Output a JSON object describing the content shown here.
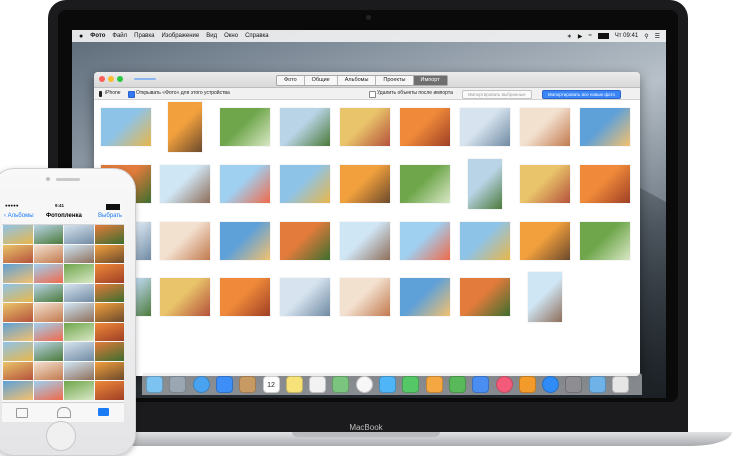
{
  "menubar": {
    "apple": "",
    "items": [
      "Фото",
      "Файл",
      "Правка",
      "Изображение",
      "Вид",
      "Окно",
      "Справка"
    ],
    "clock": "Чт 09:41",
    "status_icons": [
      "bluetooth-icon",
      "volume-icon",
      "wifi-icon",
      "battery-icon",
      "search-icon",
      "list-icon"
    ]
  },
  "photos_window": {
    "tabs": [
      "Фото",
      "Общие",
      "Альбомы",
      "Проекты",
      "Импорт"
    ],
    "active_tab": "Импорт",
    "device": "iPhone",
    "open_photos_label": "Открывать «Фото» для этого устройства",
    "delete_after_label": "Удалить объекты после импорта",
    "import_selected_label": "Импортировать выбранные",
    "import_all_label": "Импортировать все новые фото"
  },
  "dock": {
    "icons": [
      "finder-icon",
      "launchpad-icon",
      "safari-icon",
      "mail-icon",
      "contacts-icon",
      "calendar-icon",
      "notes-icon",
      "reminders-icon",
      "maps-icon",
      "photos-icon",
      "messages-icon",
      "facetime-icon",
      "pages-icon",
      "numbers-icon",
      "keynote-icon",
      "music-icon",
      "ibooks-icon",
      "appstore-icon",
      "system-preferences-icon",
      "downloads-folder-icon",
      "trash-icon"
    ],
    "calendar_day": "12"
  },
  "laptop_label": "MacBook",
  "iphone": {
    "status_left": "●●●●● ",
    "time": "9:41",
    "back_label": "Альбомы",
    "title": "Фотопленка",
    "select_label": "Выбрать"
  }
}
